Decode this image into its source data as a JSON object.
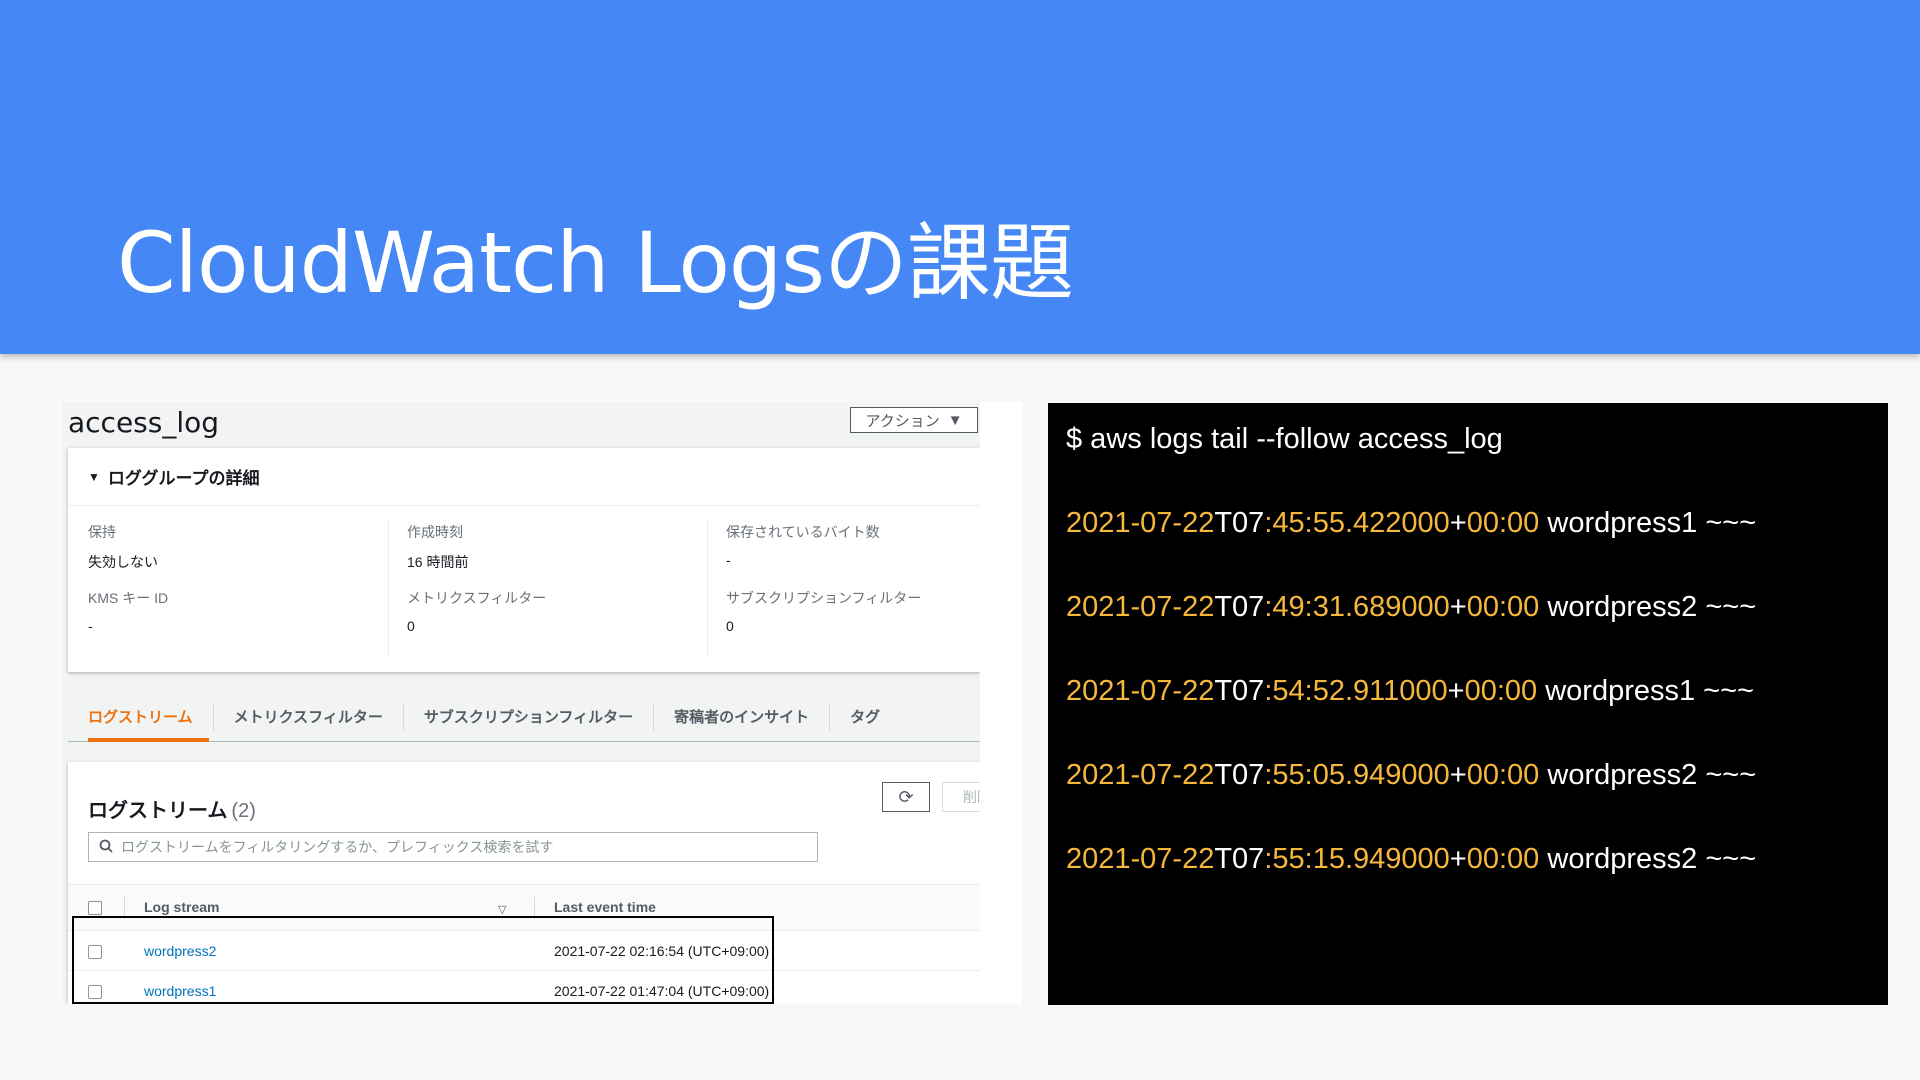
{
  "slide": {
    "title": "CloudWatch Logsの課題"
  },
  "console": {
    "log_group_name": "access_log",
    "actions_label": "アクション",
    "details": {
      "heading": "ロググループの詳細",
      "fields": [
        {
          "label": "保持",
          "value": "失効しない"
        },
        {
          "label": "作成時刻",
          "value": "16 時間前"
        },
        {
          "label": "保存されているバイト数",
          "value": "-"
        },
        {
          "label": "KMS キー ID",
          "value": "-"
        },
        {
          "label": "メトリクスフィルター",
          "value": "0"
        },
        {
          "label": "サブスクリプションフィルター",
          "value": "0"
        }
      ]
    },
    "tabs": [
      "ログストリーム",
      "メトリクスフィルター",
      "サブスクリプションフィルター",
      "寄稿者のインサイト",
      "タグ"
    ],
    "streams": {
      "title": "ログストリーム",
      "count": "(2)",
      "delete_label": "削除",
      "search_placeholder": "ログストリームをフィルタリングするか、プレフィックス検索を試す",
      "col_stream": "Log stream",
      "col_time": "Last event time",
      "rows": [
        {
          "name": "wordpress2",
          "time": "2021-07-22 02:16:54 (UTC+09:00)"
        },
        {
          "name": "wordpress1",
          "time": "2021-07-22 01:47:04 (UTC+09:00)"
        }
      ]
    }
  },
  "terminal": {
    "command": "$ aws logs tail --follow access_log",
    "lines": [
      {
        "date": "2021-07-22",
        "t": "T07",
        "time": ":45:55.422000",
        "plus": "+",
        "tz": "00:00",
        "rest": " wordpress1 ~~~"
      },
      {
        "date": "2021-07-22",
        "t": "T07",
        "time": ":49:31.689000",
        "plus": "+",
        "tz": "00:00",
        "rest": " wordpress2 ~~~"
      },
      {
        "date": "2021-07-22",
        "t": "T07",
        "time": ":54:52.911000",
        "plus": "+",
        "tz": "00:00",
        "rest": " wordpress1 ~~~"
      },
      {
        "date": "2021-07-22",
        "t": "T07",
        "time": ":55:05.949000",
        "plus": "+",
        "tz": "00:00",
        "rest": " wordpress2 ~~~"
      },
      {
        "date": "2021-07-22",
        "t": "T07",
        "time": ":55:15.949000",
        "plus": "+",
        "tz": "00:00",
        "rest": " wordpress2 ~~~"
      }
    ]
  },
  "colors": {
    "header": "#4587f4",
    "timestamp_yellow": "#f6b73c",
    "tab_active": "#ec7211",
    "link": "#0073bb"
  }
}
